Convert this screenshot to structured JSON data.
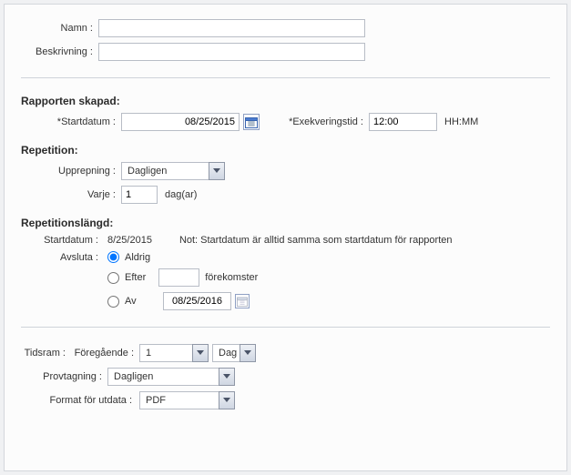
{
  "nameSection": {
    "nameLabel": "Namn :",
    "nameValue": "",
    "descLabel": "Beskrivning :",
    "descValue": ""
  },
  "reportCreated": {
    "title": "Rapporten skapad:",
    "startDateLabel": "*Startdatum :",
    "startDateValue": "08/25/2015",
    "execTimeLabel": "*Exekveringstid :",
    "execTimeValue": "12:00",
    "execTimeHint": "HH:MM"
  },
  "repetition": {
    "title": "Repetition:",
    "repeatLabel": "Upprepning :",
    "repeatValue": "Dagligen",
    "everyLabel": "Varje :",
    "everyValue": "1",
    "everyUnit": "dag(ar)"
  },
  "repLength": {
    "title": "Repetitionslängd:",
    "startDateLabel": "Startdatum :",
    "startDateValue": "8/25/2015",
    "note": "Not: Startdatum är alltid samma som startdatum för rapporten",
    "endLabel": "Avsluta :",
    "options": {
      "never": "Aldrig",
      "after": "Efter",
      "afterValue": "",
      "afterOccurrences": "förekomster",
      "by": "Av",
      "byDate": "08/25/2016"
    }
  },
  "timeframe": {
    "label": "Tidsram :",
    "prevLabel": "Föregående :",
    "prevValue": "1",
    "prevUnit": "Dag"
  },
  "sampling": {
    "label": "Provtagning :",
    "value": "Dagligen"
  },
  "outputFormat": {
    "label": "Format för utdata :",
    "value": "PDF"
  }
}
